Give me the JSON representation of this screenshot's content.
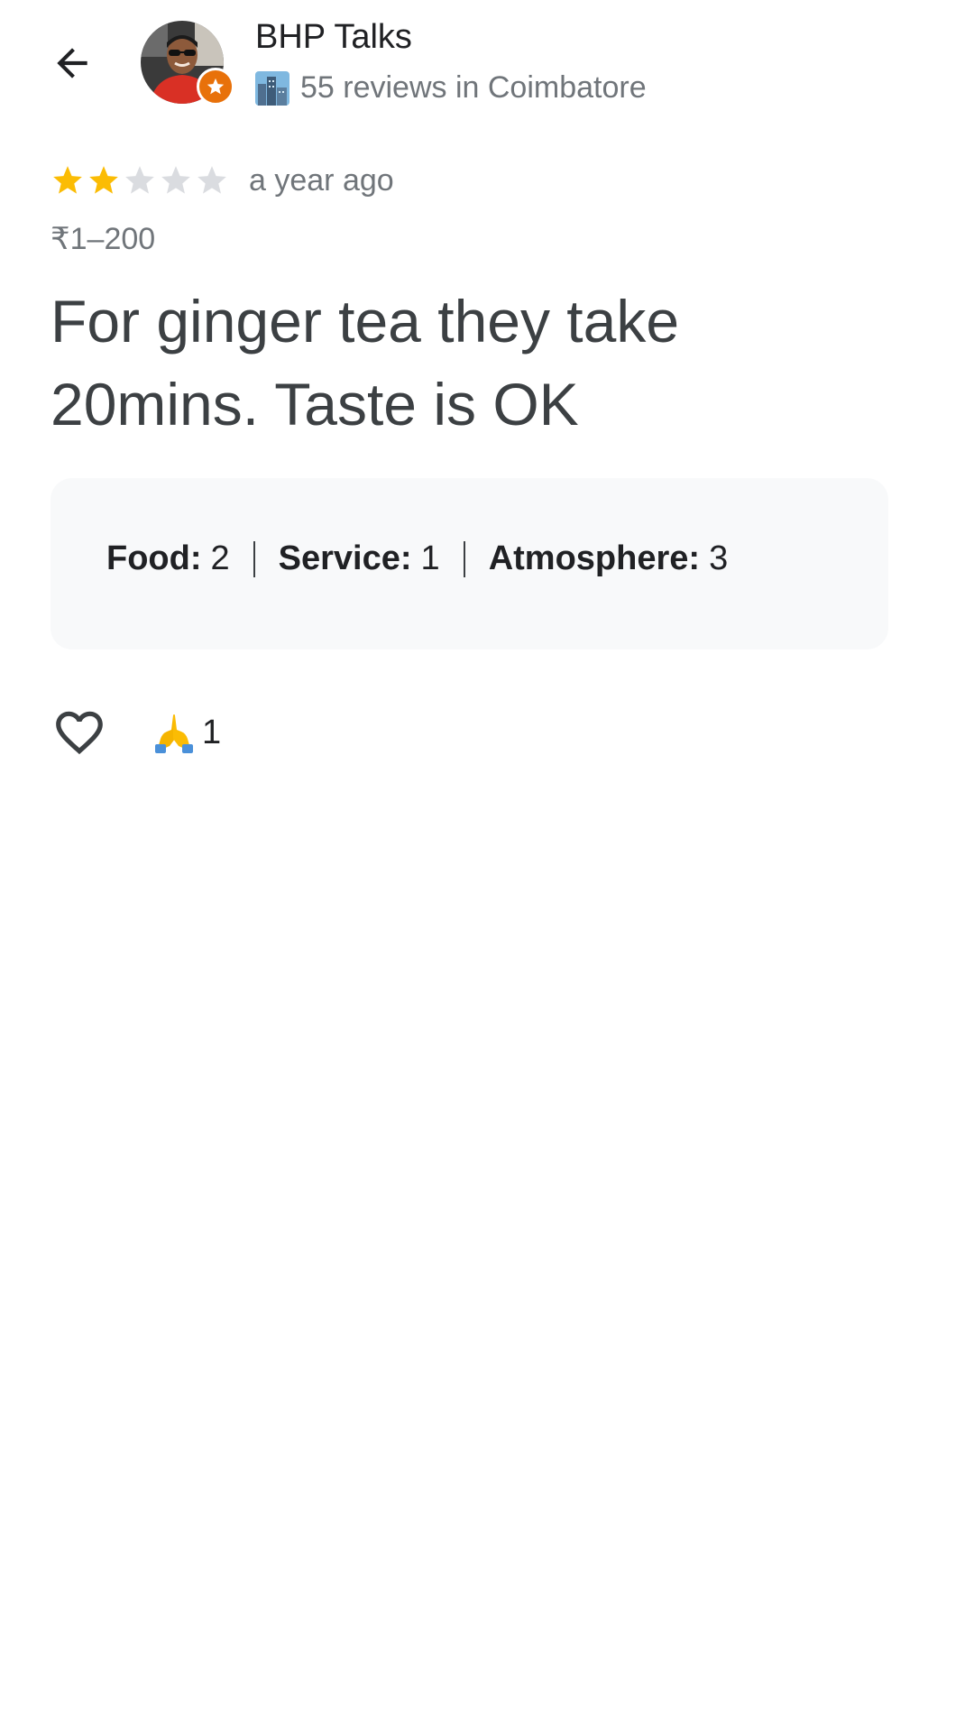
{
  "header": {
    "back_icon": "arrow-left-icon",
    "user_name": "BHP Talks",
    "user_meta": "55 reviews in Coimbatore",
    "city_icon": "cityscape-icon",
    "badge_icon": "local-guide-star-icon",
    "badge_color": "#e8710a"
  },
  "review": {
    "rating": 2,
    "rating_max": 5,
    "star_color": "#fbbc04",
    "star_empty_color": "#dadce0",
    "time_ago": "a year ago",
    "price": "₹1–200",
    "text": "For ginger tea they take 20mins. Taste is OK"
  },
  "ratings": {
    "items": [
      {
        "label": "Food:",
        "value": "2"
      },
      {
        "label": "Service:",
        "value": "1"
      },
      {
        "label": "Atmosphere:",
        "value": "3"
      }
    ]
  },
  "reactions": {
    "like_icon": "heart-outline-icon",
    "thanks_icon": "folded-hands-icon",
    "thanks_count": "1"
  }
}
